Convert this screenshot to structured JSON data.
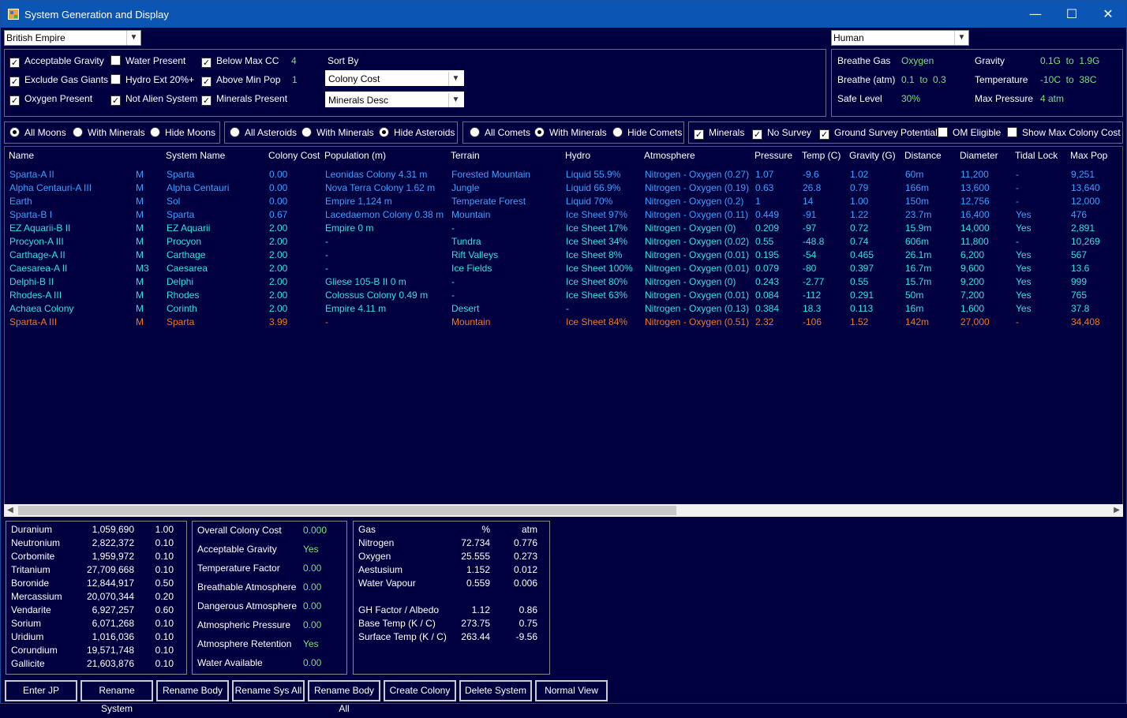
{
  "window": {
    "title": "System Generation and Display",
    "minimize": "—",
    "maximize": "☐",
    "close": "✕"
  },
  "race_select": "British Empire",
  "species_select": "Human",
  "filters": {
    "acceptable_gravity": "Acceptable Gravity",
    "water_present": "Water Present",
    "below_max_cc": "Below Max CC",
    "below_max_cc_value": "4",
    "exclude_gas_giants": "Exclude Gas Giants",
    "hydro_ext": "Hydro Ext 20%+",
    "above_min_pop": "Above Min Pop",
    "above_min_pop_value": "1",
    "oxygen_present": "Oxygen Present",
    "not_alien_system": "Not Alien System",
    "minerals_present": "Minerals Present",
    "sort_by": "Sort By",
    "sort1": "Colony Cost",
    "sort2": "Minerals Desc"
  },
  "species": {
    "breathe_gas_label": "Breathe Gas",
    "breathe_gas": "Oxygen",
    "breathe_atm_label": "Breathe (atm)",
    "breathe_atm": "0.1  to  0.3",
    "safe_level_label": "Safe Level",
    "safe_level": "30%",
    "gravity_label": "Gravity",
    "gravity": "0.1G  to  1.9G",
    "temperature_label": "Temperature",
    "temperature": "-10C  to  38C",
    "max_pressure_label": "Max Pressure",
    "max_pressure": "4 atm"
  },
  "options": {
    "all_moons": "All Moons",
    "with_minerals_moons": "With Minerals",
    "hide_moons": "Hide Moons",
    "all_asteroids": "All Asteroids",
    "with_minerals_asteroids": "With Minerals",
    "hide_asteroids": "Hide Asteroids",
    "all_comets": "All Comets",
    "with_minerals_comets": "With Minerals",
    "hide_comets": "Hide Comets",
    "minerals": "Minerals",
    "no_survey": "No Survey",
    "ground_survey": "Ground Survey Potential",
    "om_eligible": "OM Eligible",
    "show_max_cc": "Show Max Colony Cost"
  },
  "columns": [
    "Name",
    "System Name",
    "Colony Cost",
    "Population (m)",
    "Terrain",
    "Hydro",
    "Atmosphere",
    "Pressure",
    "Temp (C)",
    "Gravity (G)",
    "Distance",
    "Diameter",
    "Tidal Lock",
    "Max Pop"
  ],
  "rows": [
    {
      "color": "blue",
      "name": "Sparta-A II",
      "type": "M",
      "system": "Sparta",
      "cc": "0.00",
      "pop": "Leonidas Colony 4.31 m",
      "terrain": "Forested Mountain",
      "hydro": "Liquid 55.9%",
      "atmo": "Nitrogen - Oxygen (0.27)",
      "pres": "1.07",
      "temp": "-9.6",
      "grav": "1.02",
      "dist": "60m",
      "diam": "11,200",
      "tidal": "-",
      "maxpop": "9,251"
    },
    {
      "color": "blue",
      "name": "Alpha Centauri-A III",
      "type": "M",
      "system": "Alpha Centauri",
      "cc": "0.00",
      "pop": "Nova Terra Colony 1.62 m",
      "terrain": "Jungle",
      "hydro": "Liquid 66.9%",
      "atmo": "Nitrogen - Oxygen (0.19)",
      "pres": "0.63",
      "temp": "26.8",
      "grav": "0.79",
      "dist": "166m",
      "diam": "13,600",
      "tidal": "-",
      "maxpop": "13,640"
    },
    {
      "color": "blue",
      "name": "Earth",
      "type": "M",
      "system": "Sol",
      "cc": "0.00",
      "pop": "Empire 1,124 m",
      "terrain": "Temperate Forest",
      "hydro": "Liquid 70%",
      "atmo": "Nitrogen - Oxygen (0.2)",
      "pres": "1",
      "temp": "14",
      "grav": "1.00",
      "dist": "150m",
      "diam": "12,756",
      "tidal": "-",
      "maxpop": "12,000"
    },
    {
      "color": "blue",
      "name": "Sparta-B I",
      "type": "M",
      "system": "Sparta",
      "cc": "0.67",
      "pop": "Lacedaemon Colony 0.38 m",
      "terrain": "Mountain",
      "hydro": "Ice Sheet 97%",
      "atmo": "Nitrogen - Oxygen (0.11)",
      "pres": "0.449",
      "temp": "-91",
      "grav": "1.22",
      "dist": "23.7m",
      "diam": "16,400",
      "tidal": "Yes",
      "maxpop": "476"
    },
    {
      "color": "cyan",
      "name": "EZ Aquarii-B II",
      "type": "M",
      "system": "EZ Aquarii",
      "cc": "2.00",
      "pop": "Empire 0 m",
      "terrain": "-",
      "hydro": "Ice Sheet 17%",
      "atmo": "Nitrogen - Oxygen (0)",
      "pres": "0.209",
      "temp": "-97",
      "grav": "0.72",
      "dist": "15.9m",
      "diam": "14,000",
      "tidal": "Yes",
      "maxpop": "2,891"
    },
    {
      "color": "cyan",
      "name": "Procyon-A III",
      "type": "M",
      "system": "Procyon",
      "cc": "2.00",
      "pop": "-",
      "terrain": "Tundra",
      "hydro": "Ice Sheet 34%",
      "atmo": "Nitrogen - Oxygen (0.02)",
      "pres": "0.55",
      "temp": "-48.8",
      "grav": "0.74",
      "dist": "606m",
      "diam": "11,800",
      "tidal": "-",
      "maxpop": "10,269"
    },
    {
      "color": "cyan",
      "name": "Carthage-A II",
      "type": "M",
      "system": "Carthage",
      "cc": "2.00",
      "pop": "-",
      "terrain": "Rift Valleys",
      "hydro": "Ice Sheet 8%",
      "atmo": "Nitrogen - Oxygen (0.01)",
      "pres": "0.195",
      "temp": "-54",
      "grav": "0.465",
      "dist": "26.1m",
      "diam": "6,200",
      "tidal": "Yes",
      "maxpop": "567"
    },
    {
      "color": "cyan",
      "name": "Caesarea-A II",
      "type": "M3",
      "system": "Caesarea",
      "cc": "2.00",
      "pop": "-",
      "terrain": "Ice Fields",
      "hydro": "Ice Sheet 100%",
      "atmo": "Nitrogen - Oxygen (0.01)",
      "pres": "0.079",
      "temp": "-80",
      "grav": "0.397",
      "dist": "16.7m",
      "diam": "9,600",
      "tidal": "Yes",
      "maxpop": "13.6"
    },
    {
      "color": "cyan",
      "name": "Delphi-B II",
      "type": "M",
      "system": "Delphi",
      "cc": "2.00",
      "pop": "Gliese 105-B II 0 m",
      "terrain": "-",
      "hydro": "Ice Sheet 80%",
      "atmo": "Nitrogen - Oxygen (0)",
      "pres": "0.243",
      "temp": "-2.77",
      "grav": "0.55",
      "dist": "15.7m",
      "diam": "9,200",
      "tidal": "Yes",
      "maxpop": "999"
    },
    {
      "color": "cyan",
      "name": "Rhodes-A III",
      "type": "M",
      "system": "Rhodes",
      "cc": "2.00",
      "pop": "Colossus Colony 0.49 m",
      "terrain": "-",
      "hydro": "Ice Sheet 63%",
      "atmo": "Nitrogen - Oxygen (0.01)",
      "pres": "0.084",
      "temp": "-112",
      "grav": "0.291",
      "dist": "50m",
      "diam": "7,200",
      "tidal": "Yes",
      "maxpop": "765"
    },
    {
      "color": "cyan",
      "name": "Achaea Colony",
      "type": "M",
      "system": "Corinth",
      "cc": "2.00",
      "pop": "Empire 4.11 m",
      "terrain": "Desert",
      "hydro": "-",
      "atmo": "Nitrogen - Oxygen (0.13)",
      "pres": "0.384",
      "temp": "18.3",
      "grav": "0.113",
      "dist": "16m",
      "diam": "1,600",
      "tidal": "Yes",
      "maxpop": "37.8"
    },
    {
      "color": "orange",
      "name": "Sparta-A III",
      "type": "M",
      "system": "Sparta",
      "cc": "3.99",
      "pop": "-",
      "terrain": "Mountain",
      "hydro": "Ice Sheet 84%",
      "atmo": "Nitrogen - Oxygen (0.51)",
      "pres": "2.32",
      "temp": "-106",
      "grav": "1.52",
      "dist": "142m",
      "diam": "27,000",
      "tidal": "-",
      "maxpop": "34,408"
    }
  ],
  "minerals": [
    {
      "name": "Duranium",
      "amount": "1,059,690",
      "acc": "1.00"
    },
    {
      "name": "Neutronium",
      "amount": "2,822,372",
      "acc": "0.10"
    },
    {
      "name": "Corbomite",
      "amount": "1,959,972",
      "acc": "0.10"
    },
    {
      "name": "Tritanium",
      "amount": "27,709,668",
      "acc": "0.10"
    },
    {
      "name": "Boronide",
      "amount": "12,844,917",
      "acc": "0.50"
    },
    {
      "name": "Mercassium",
      "amount": "20,070,344",
      "acc": "0.20"
    },
    {
      "name": "Vendarite",
      "amount": "6,927,257",
      "acc": "0.60"
    },
    {
      "name": "Sorium",
      "amount": "6,071,268",
      "acc": "0.10"
    },
    {
      "name": "Uridium",
      "amount": "1,016,036",
      "acc": "0.10"
    },
    {
      "name": "Corundium",
      "amount": "19,571,748",
      "acc": "0.10"
    },
    {
      "name": "Gallicite",
      "amount": "21,603,876",
      "acc": "0.10"
    }
  ],
  "colony_cost": [
    {
      "label": "Overall Colony Cost",
      "value": "0.000"
    },
    {
      "label": "Acceptable Gravity",
      "value": "Yes"
    },
    {
      "label": "Temperature Factor",
      "value": "0.00"
    },
    {
      "label": "Breathable Atmosphere",
      "value": "0.00"
    },
    {
      "label": "Dangerous Atmosphere",
      "value": "0.00"
    },
    {
      "label": "Atmospheric Pressure",
      "value": "0.00"
    },
    {
      "label": "Atmosphere Retention",
      "value": "Yes"
    },
    {
      "label": "Water Available",
      "value": "0.00"
    }
  ],
  "gas": {
    "headers": [
      "Gas",
      "%",
      "atm"
    ],
    "rows": [
      {
        "name": "Nitrogen",
        "pct": "72.734",
        "atm": "0.776"
      },
      {
        "name": "Oxygen",
        "pct": "25.555",
        "atm": "0.273"
      },
      {
        "name": "Aestusium",
        "pct": "1.152",
        "atm": "0.012"
      },
      {
        "name": "Water Vapour",
        "pct": "0.559",
        "atm": "0.006"
      }
    ],
    "extra": [
      {
        "name": "GH Factor / Albedo",
        "a": "1.12",
        "b": "0.86"
      },
      {
        "name": "Base Temp (K / C)",
        "a": "273.75",
        "b": "0.75"
      },
      {
        "name": "Surface Temp (K / C)",
        "a": "263.44",
        "b": "-9.56"
      }
    ]
  },
  "buttons": [
    "Enter JP",
    "Rename System",
    "Rename Body",
    "Rename Sys All",
    "Rename Body All",
    "Create Colony",
    "Delete System",
    "Normal View"
  ]
}
